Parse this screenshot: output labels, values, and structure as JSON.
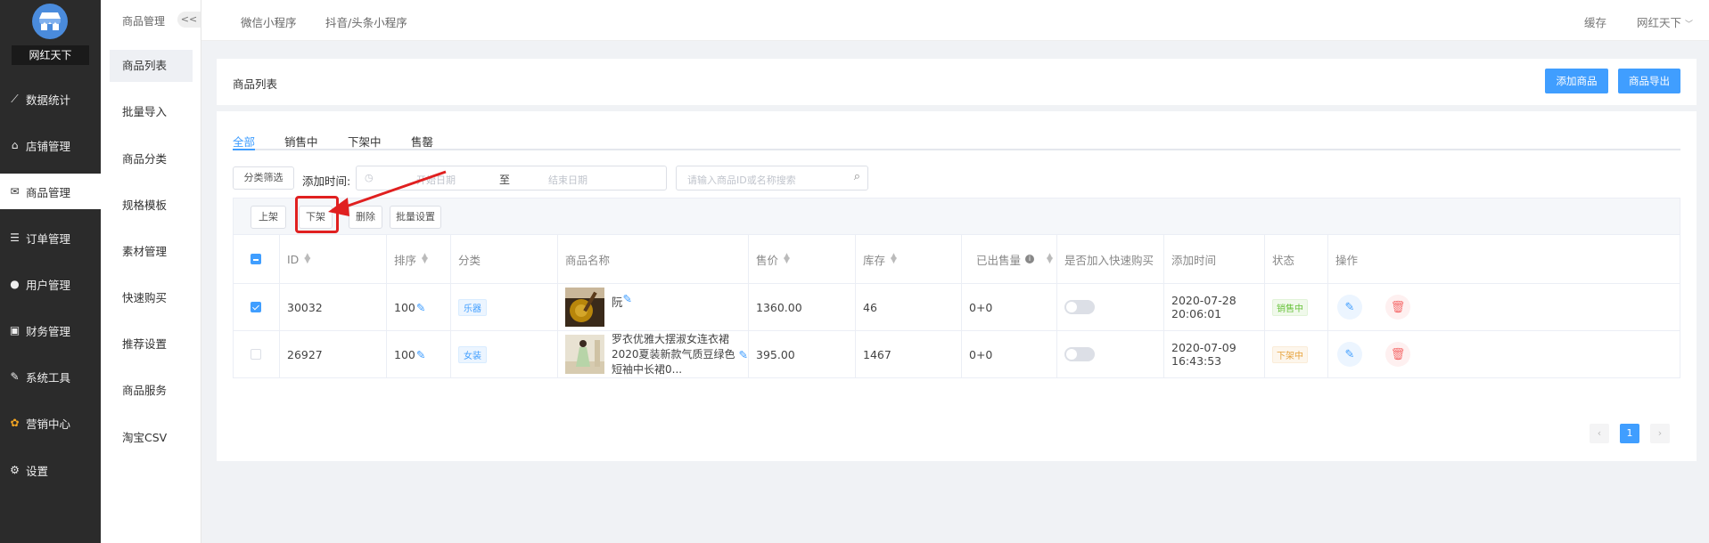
{
  "sidebar": {
    "brand": "网红天下",
    "items": [
      {
        "label": "数据统计",
        "icon": "chart-line-icon"
      },
      {
        "label": "店铺管理",
        "icon": "shop-icon"
      },
      {
        "label": "商品管理",
        "icon": "mail-icon"
      },
      {
        "label": "订单管理",
        "icon": "list-icon"
      },
      {
        "label": "用户管理",
        "icon": "user-icon"
      },
      {
        "label": "财务管理",
        "icon": "finance-icon"
      },
      {
        "label": "系统工具",
        "icon": "wrench-icon"
      },
      {
        "label": "营销中心",
        "icon": "marketing-icon"
      },
      {
        "label": "设置",
        "icon": "gear-icon"
      }
    ]
  },
  "submenu": {
    "title": "商品管理",
    "collapse": "<<",
    "items": [
      "商品列表",
      "批量导入",
      "商品分类",
      "规格模板",
      "素材管理",
      "快速购买",
      "推荐设置",
      "商品服务",
      "淘宝CSV"
    ]
  },
  "topbar": {
    "tabs": [
      "微信小程序",
      "抖音/头条小程序"
    ],
    "cache": "缓存",
    "user": "网红天下"
  },
  "header": {
    "title": "商品列表",
    "add_button": "添加商品",
    "export_button": "商品导出"
  },
  "filters": {
    "tabs": [
      "全部",
      "销售中",
      "下架中",
      "售罄"
    ],
    "category_filter": "分类筛选",
    "date_label": "添加时间:",
    "start_placeholder": "开始日期",
    "separator": "至",
    "end_placeholder": "结束日期",
    "search_placeholder": "请输入商品ID或名称搜索"
  },
  "actions": {
    "on_shelf": "上架",
    "off_shelf": "下架",
    "delete": "删除",
    "batch_settings": "批量设置"
  },
  "table": {
    "columns": [
      "ID",
      "排序",
      "分类",
      "商品名称",
      "售价",
      "库存",
      "已出售量",
      "是否加入快速购买",
      "添加时间",
      "状态",
      "操作"
    ],
    "rows": [
      {
        "checked": true,
        "id": "30032",
        "sort": "100",
        "category": "乐器",
        "name": "阮",
        "price": "1360.00",
        "stock": "46",
        "sold": "0+0",
        "quick_buy": false,
        "added": "2020-07-28 20:06:01",
        "status": "销售中",
        "status_color": "#67c23a"
      },
      {
        "checked": false,
        "id": "26927",
        "sort": "100",
        "category": "女装",
        "name": "罗衣优雅大摆淑女连衣裙2020夏装新款气质豆绿色短袖中长裙0...",
        "price": "395.00",
        "stock": "1467",
        "sold": "0+0",
        "quick_buy": false,
        "added": "2020-07-09 16:43:53",
        "status": "下架中",
        "status_color": "#e6a23c"
      }
    ]
  },
  "pagination": {
    "current": "1"
  },
  "colors": {
    "primary": "#409eff",
    "danger": "#f56c6c",
    "sidebar": "#2b2b2b",
    "annotation": "#e02020"
  }
}
